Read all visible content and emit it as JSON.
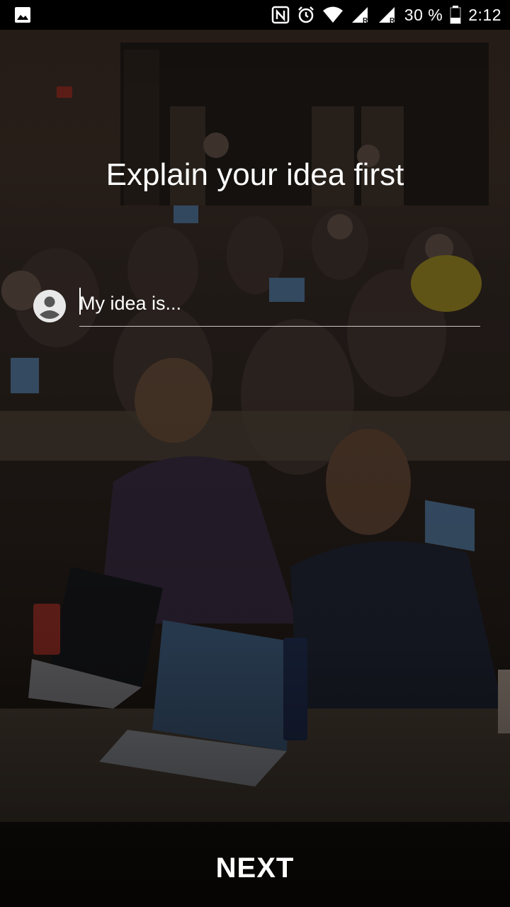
{
  "status_bar": {
    "battery_percent": "30 %",
    "time": "2:12",
    "icons": [
      "gallery-icon",
      "nfc-icon",
      "alarm-icon",
      "wifi-icon",
      "signal-icon",
      "signal-icon",
      "battery-icon"
    ],
    "network_marker": "R"
  },
  "screen": {
    "title": "Explain your idea first",
    "idea_input": {
      "value": "",
      "placeholder": "My idea is..."
    },
    "next_label": "NEXT",
    "background_image": "hackathon-room-photo",
    "colors": {
      "text": "#ffffff",
      "status_bar": "#000000"
    }
  }
}
